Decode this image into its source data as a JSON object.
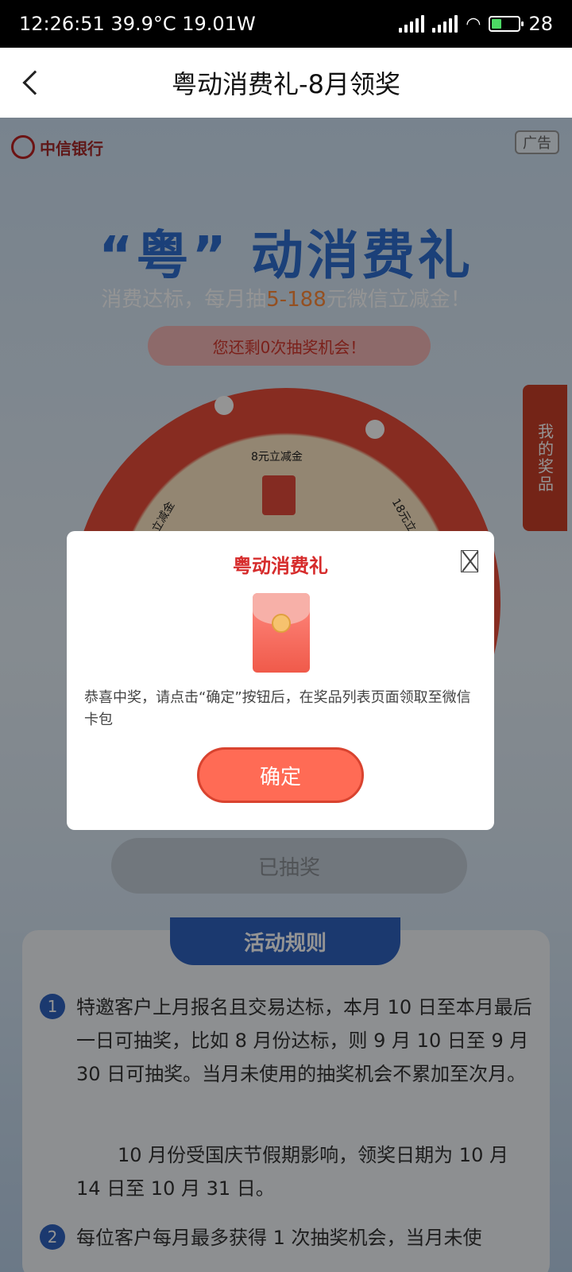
{
  "status_bar": {
    "time_info": "12:26:51 39.9°C 19.01W",
    "battery_level": "28"
  },
  "header": {
    "title": "粤动消费礼-8月领奖"
  },
  "page": {
    "bank_name": "中信银行",
    "ad_tag": "广告",
    "hero_title": "“粤” 动消费礼",
    "subtitle_pre": "消费达标，每月抽",
    "subtitle_highlight": "5-188",
    "subtitle_post": "元微信立减金！",
    "remaining": "您还剩0次抽奖机会！",
    "my_prizes": "我的奖品",
    "wheel_prizes": [
      "8元立减金",
      "立减金",
      "18元立"
    ],
    "drawn_button": "已抽奖",
    "rules_title": "活动规则",
    "rules": [
      {
        "num": "1",
        "text": "特邀客户上月报名且交易达标，本月 10 日至本月最后一日可抽奖，比如 8 月份达标，则 9 月 10 日至 9 月 30 日可抽奖。当月未使用的抽奖机会不累加至次月。"
      },
      {
        "num": "2",
        "text": "每位客户每月最多获得 1 次抽奖机会，当月未使"
      }
    ],
    "rule_note": "10 月份受国庆节假期影响，领奖日期为 10 月 14 日至 10 月 31 日。"
  },
  "modal": {
    "title": "粤动消费礼",
    "message": "恭喜中奖，请点击“确定”按钮后，在奖品列表页面领取至微信卡包",
    "confirm_label": "确定"
  }
}
